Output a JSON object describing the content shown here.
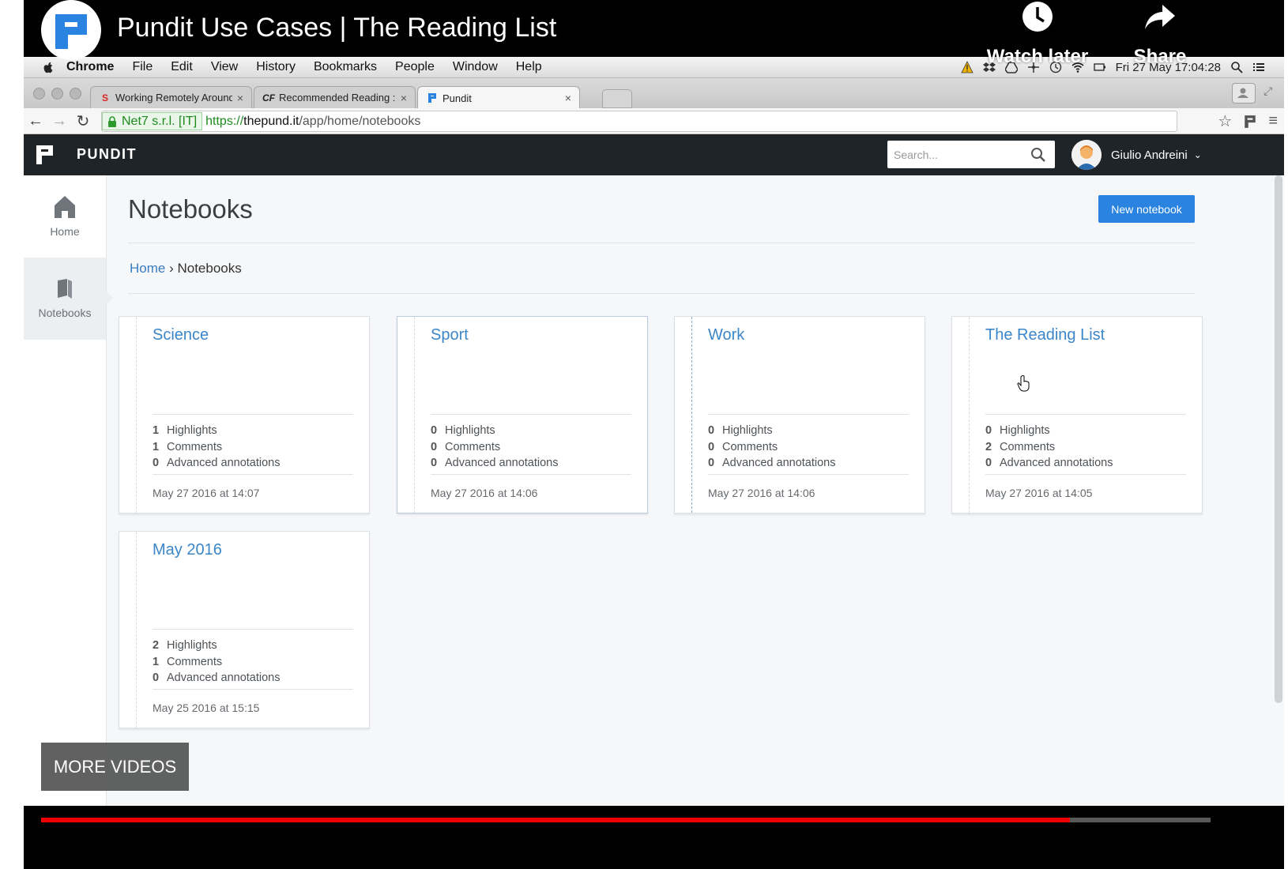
{
  "video": {
    "title": "Pundit Use Cases | The Reading List",
    "watch_later": "Watch later",
    "share": "Share",
    "more_videos": "MORE VIDEOS",
    "progress_percent": 88
  },
  "menubar": {
    "app": "Chrome",
    "items": [
      "File",
      "Edit",
      "View",
      "History",
      "Bookmarks",
      "People",
      "Window",
      "Help"
    ],
    "clock": "Fri 27 May  17:04:28"
  },
  "browser": {
    "tabs": [
      {
        "title": "Working Remotely Around",
        "favicon": "S"
      },
      {
        "title": "Recommended Reading : T",
        "favicon": "CF"
      },
      {
        "title": "Pundit",
        "favicon": "pundit"
      }
    ],
    "ev_label": "Net7 s.r.l. [IT]",
    "url_scheme": "https://",
    "url_host": "thepund.it",
    "url_path": "/app/home/notebooks"
  },
  "app": {
    "brand": "PUNDIT",
    "search_placeholder": "Search...",
    "user_name": "Giulio Andreini",
    "nav": [
      {
        "label": "Home",
        "icon": "home-icon"
      },
      {
        "label": "Notebooks",
        "icon": "book-icon"
      }
    ],
    "page_title": "Notebooks",
    "new_notebook": "New notebook",
    "breadcrumb": {
      "home": "Home",
      "sep": " › ",
      "current": "Notebooks"
    },
    "stat_labels": {
      "highlights": "Highlights",
      "comments": "Comments",
      "advanced": "Advanced annotations"
    },
    "notebooks": [
      {
        "name": "Science",
        "highlights": "1",
        "comments": "1",
        "advanced": "0",
        "date": "May 27 2016 at 14:07"
      },
      {
        "name": "Sport",
        "highlights": "0",
        "comments": "0",
        "advanced": "0",
        "date": "May 27 2016 at 14:06"
      },
      {
        "name": "Work",
        "highlights": "0",
        "comments": "0",
        "advanced": "0",
        "date": "May 27 2016 at 14:06"
      },
      {
        "name": "The Reading List",
        "highlights": "0",
        "comments": "2",
        "advanced": "0",
        "date": "May 27 2016 at 14:05"
      },
      {
        "name": "May 2016",
        "highlights": "2",
        "comments": "1",
        "advanced": "0",
        "date": "May 25 2016 at 15:15"
      }
    ]
  },
  "colors": {
    "accent": "#2a83e0",
    "link": "#3c86c8",
    "topbar": "#1f2429",
    "progress": "#ee0000"
  }
}
